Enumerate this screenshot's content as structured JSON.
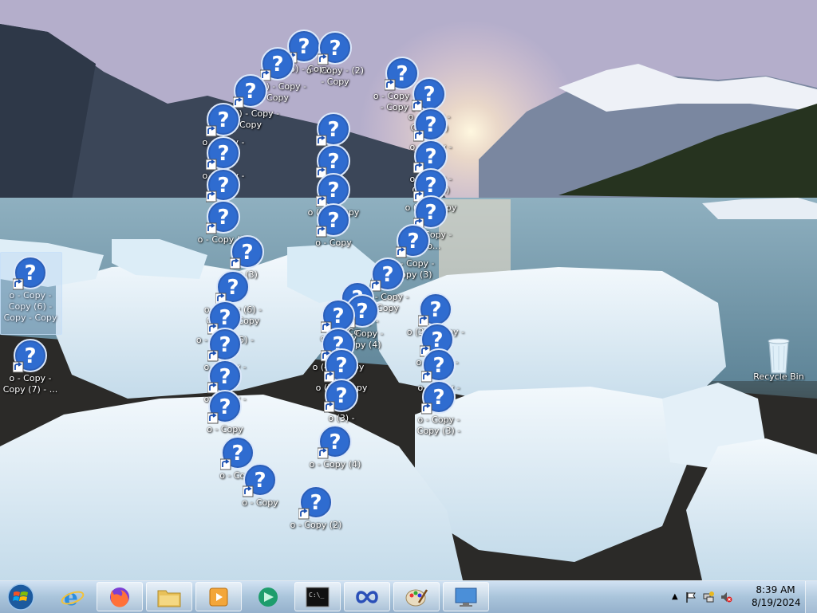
{
  "desktop": {
    "icons": [
      {
        "label": "o - Copy - Copy (6) - Copy - Copy",
        "selected": true
      },
      {
        "label": "o - Copy - Copy (7) - ..."
      },
      {
        "label": "o (5) - Copy"
      },
      {
        "label": "o (5) - Copy - Copy"
      },
      {
        "label": "o - Copy - (2) - Copy"
      },
      {
        "label": "o (3) - Copy - Copy"
      },
      {
        "label": "o - Copy - (2) - Copy (4)"
      },
      {
        "label": "o - Copy - Co..."
      },
      {
        "label": "o - Copy - Copy"
      },
      {
        "label": "o"
      },
      {
        "label": "o (2)"
      },
      {
        "label": "o (2) - Copy"
      },
      {
        "label": "o - Copy"
      },
      {
        "label": "o (3)"
      },
      {
        "label": "o - Copy - Copy (3)"
      },
      {
        "label": "o - Copy - Copy"
      },
      {
        "label": "o - Copy - Copy (3)"
      },
      {
        "label": "o - Copy (4)"
      },
      {
        "label": "o (3)"
      },
      {
        "label": "o (4) - Copy"
      },
      {
        "label": "o - Copy - Co..."
      },
      {
        "label": "o - Copy - Copy (3)"
      },
      {
        "label": "o - Copy - Copy"
      },
      {
        "label": "o - Copy - Co..."
      },
      {
        "label": "o - Copy (6) - Copy - Copy"
      },
      {
        "label": "o - Copy - Copy (4)"
      },
      {
        "label": "o - Copy (5) -"
      },
      {
        "label": "o (2) - Copy - Copy"
      },
      {
        "label": "o - Copy - Co..."
      },
      {
        "label": "o - Copy - Co..."
      },
      {
        "label": "o - Copy - Copy"
      },
      {
        "label": "o - Copy"
      },
      {
        "label": "o (4) - Copy"
      },
      {
        "label": "o (3) - Copy"
      },
      {
        "label": "o - Copy - Co..."
      },
      {
        "label": "o (3) -"
      },
      {
        "label": "o - Copy"
      },
      {
        "label": "o - Copy - Copy (3) -"
      },
      {
        "label": "o - Copy (4)"
      },
      {
        "label": "o - Copy"
      },
      {
        "label": "o - Copy"
      },
      {
        "label": "o - Copy (2)"
      }
    ],
    "recycle_bin": {
      "label": "Recycle Bin"
    }
  },
  "taskbar": {
    "start_label": "Start",
    "pinned": [
      {
        "name": "internet-explorer",
        "icon": "ie-icon"
      },
      {
        "name": "firefox",
        "icon": "firefox-icon"
      },
      {
        "name": "file-explorer",
        "icon": "folder-icon"
      },
      {
        "name": "media-player",
        "icon": "media-icon"
      },
      {
        "name": "green-app",
        "icon": "green-app-icon"
      },
      {
        "name": "command-prompt",
        "icon": "cmd-icon"
      },
      {
        "name": "blue-infinity-app",
        "icon": "infinity-icon"
      },
      {
        "name": "paint",
        "icon": "paint-icon"
      },
      {
        "name": "remote-desktop",
        "icon": "monitor-icon"
      }
    ],
    "clock": {
      "time": "8:39 AM",
      "date": "8/19/2024"
    }
  },
  "colors": {
    "icon_blue": "#2c5fb8",
    "taskbar": "#a6bfd6"
  }
}
